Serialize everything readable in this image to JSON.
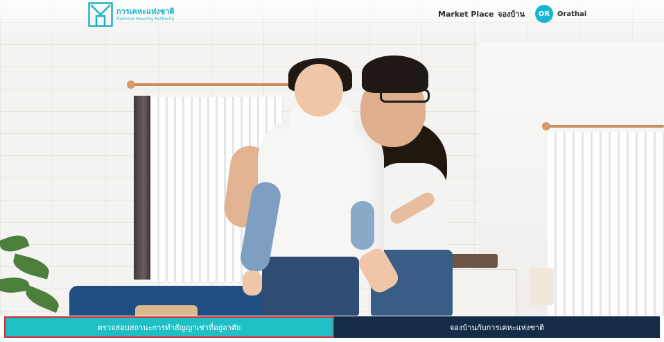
{
  "header": {
    "logo": {
      "name_th": "การเคหะแห่งชาติ",
      "name_en": "National Housing Authority",
      "icon": "nha-logo-icon",
      "color": "#1ab3c6"
    },
    "nav": {
      "market_place": "Market Place",
      "booking": "จองบ้าน"
    },
    "user": {
      "initials": "OR",
      "name": "Orathai",
      "avatar_color": "#19b6d1"
    }
  },
  "hero": {
    "image": "family-playing-at-home-photo"
  },
  "actions": {
    "check_contract": "ตรวจสอบสถานะการทำสัญญาเช่าที่อยู่อาศัย",
    "reserve_house": "จองบ้านกับการเคหะแห่งชาติ",
    "check_contract_color": "#1ec0c6",
    "reserve_house_color": "#152c49",
    "highlight_color": "#d92b34"
  }
}
